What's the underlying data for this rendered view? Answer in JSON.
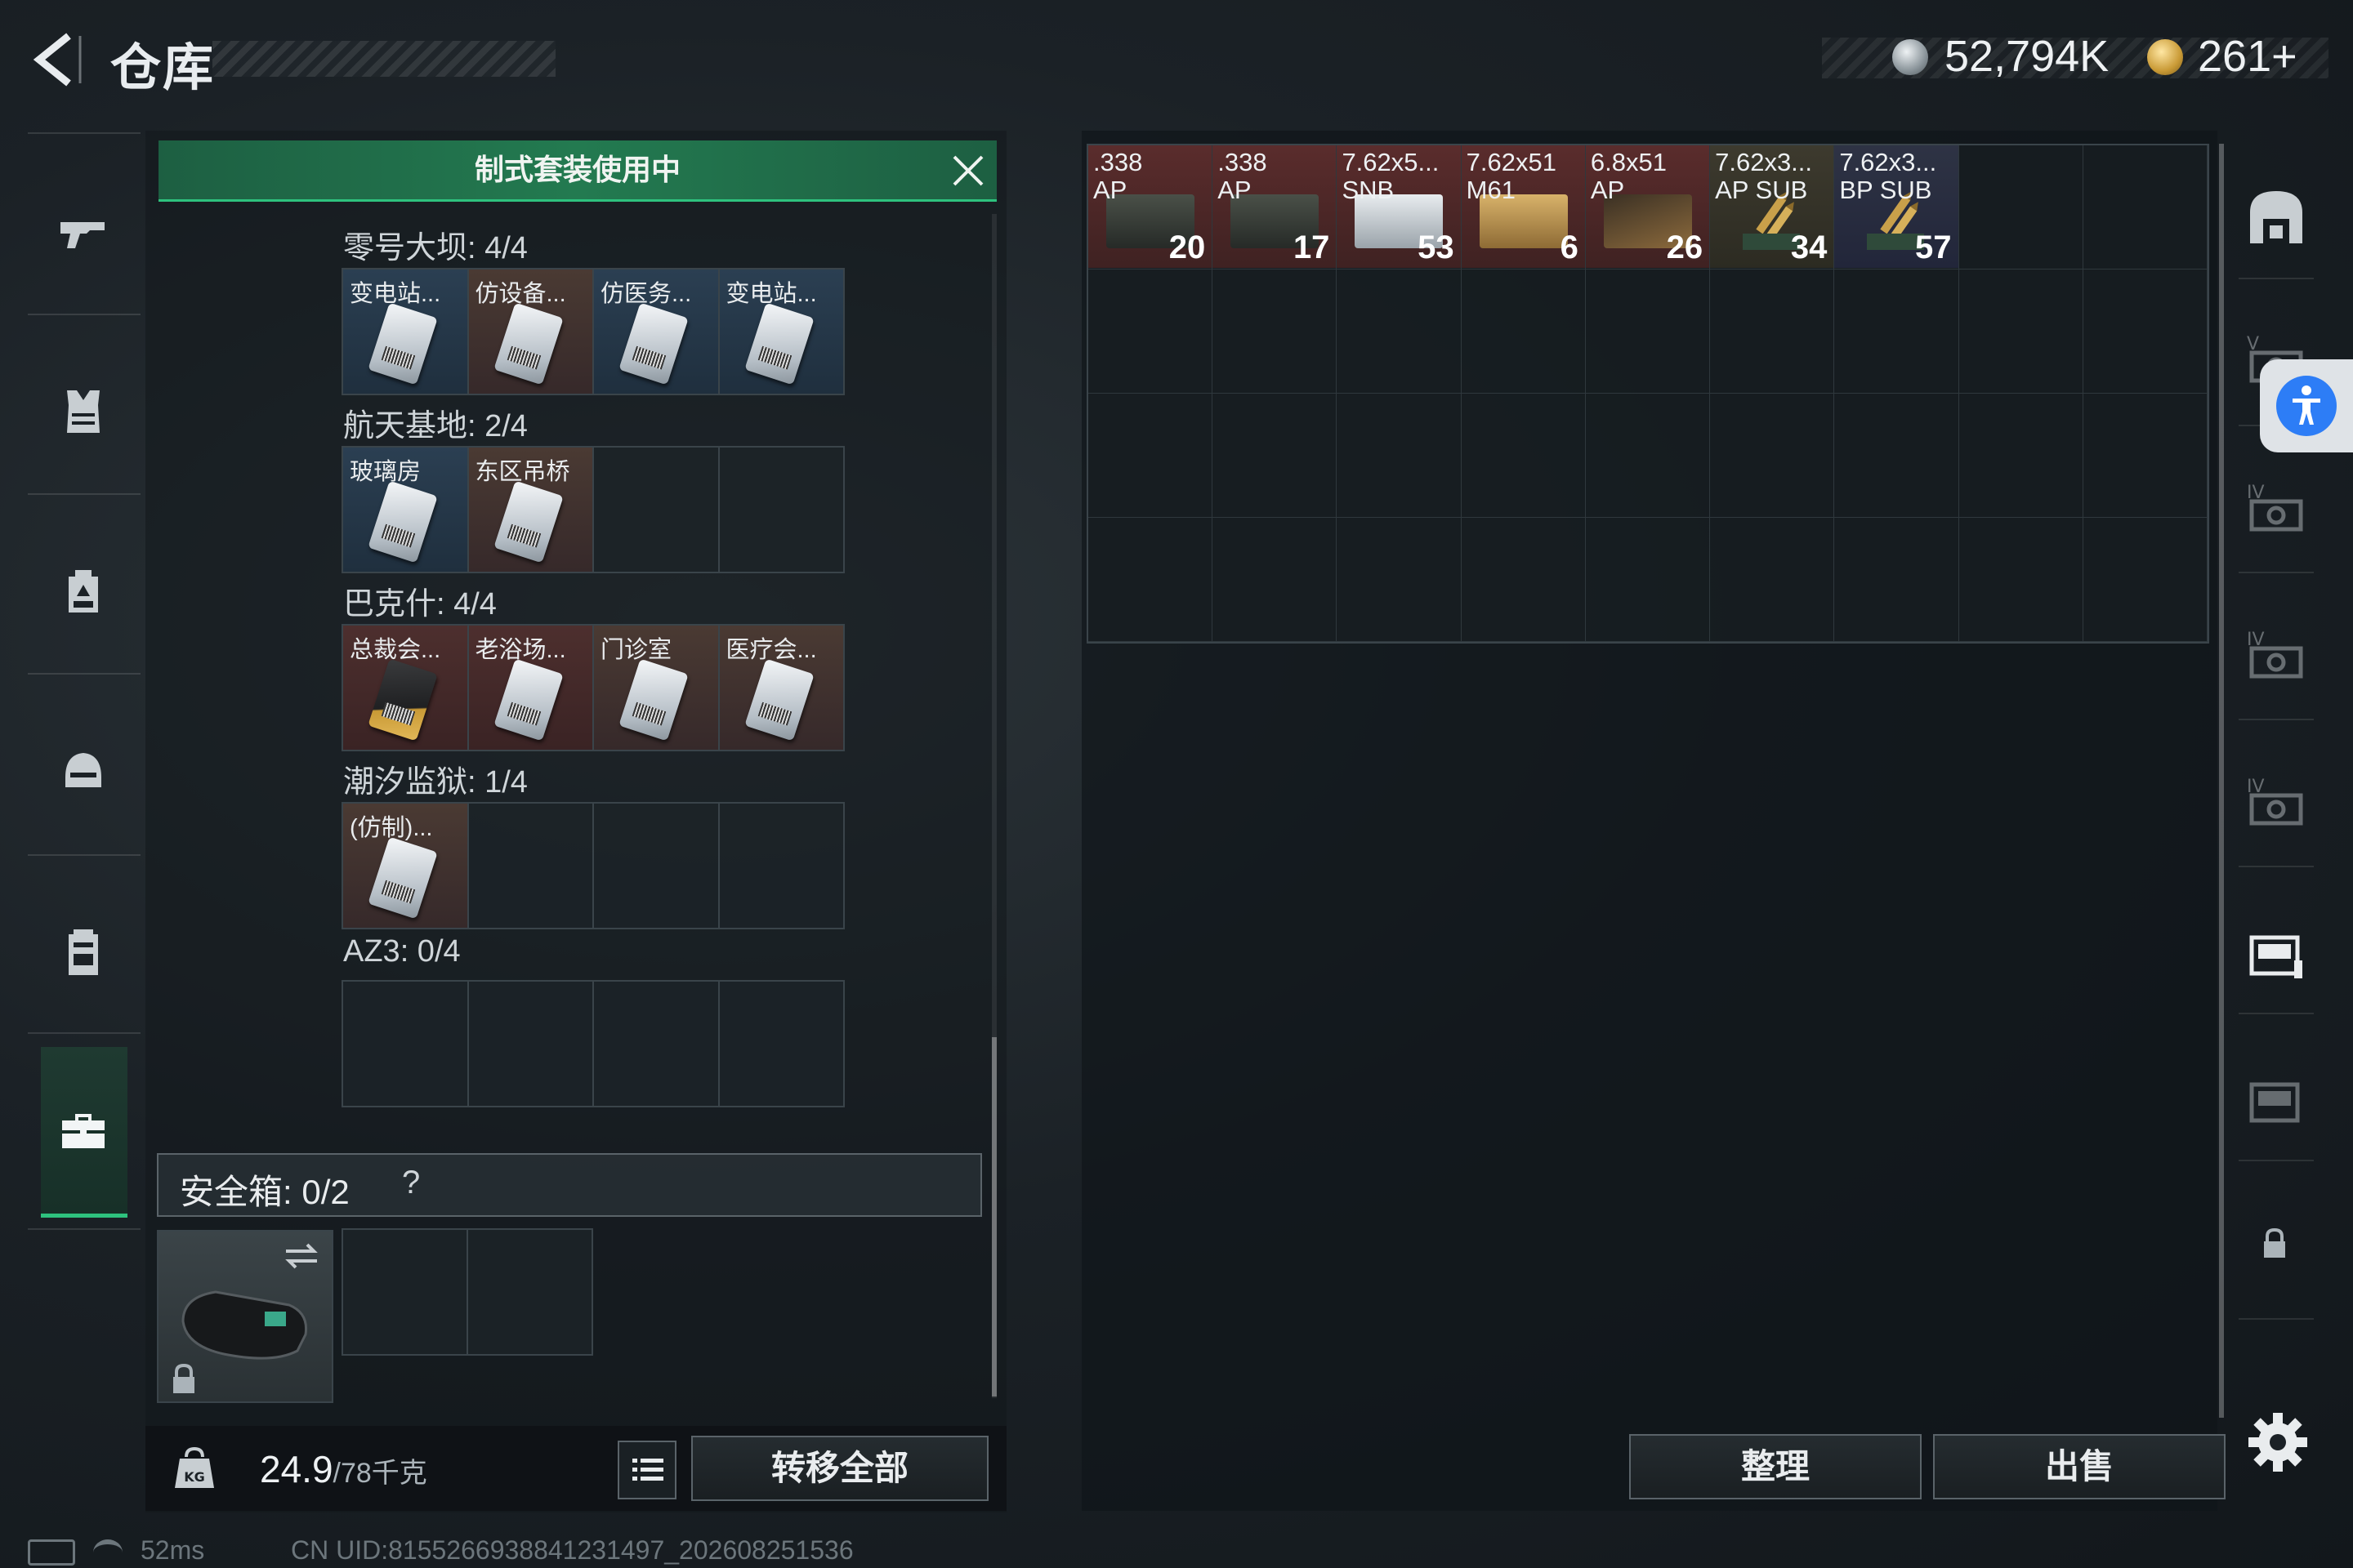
{
  "header": {
    "title": "仓库",
    "money": "52,794K",
    "gold": "261+"
  },
  "sidebar": {
    "items": [
      {
        "icon": "gun-icon"
      },
      {
        "icon": "armor-vest-icon"
      },
      {
        "icon": "backpack-icon"
      },
      {
        "icon": "helmet-icon"
      },
      {
        "icon": "rig-icon"
      },
      {
        "icon": "briefcase-icon",
        "active": true
      }
    ]
  },
  "banner": {
    "text": "制式套装使用中"
  },
  "key_sets": [
    {
      "label": "零号大坝: 4/4",
      "slots": [
        {
          "name": "变电站...",
          "tone": "blue"
        },
        {
          "name": "仿设备...",
          "tone": "brown"
        },
        {
          "name": "仿医务...",
          "tone": "blue"
        },
        {
          "name": "变电站...",
          "tone": "blue"
        }
      ]
    },
    {
      "label": "航天基地: 2/4",
      "slots": [
        {
          "name": "玻璃房",
          "tone": "blue"
        },
        {
          "name": "东区吊桥",
          "tone": "brown"
        },
        {
          "name": "",
          "tone": "empty"
        },
        {
          "name": "",
          "tone": "empty"
        }
      ]
    },
    {
      "label": "巴克什: 4/4",
      "slots": [
        {
          "name": "总裁会...",
          "tone": "red",
          "gold": true
        },
        {
          "name": "老浴场...",
          "tone": "red"
        },
        {
          "name": "门诊室",
          "tone": "brown"
        },
        {
          "name": "医疗会...",
          "tone": "brown"
        }
      ]
    },
    {
      "label": "潮汐监狱: 1/4",
      "slots": [
        {
          "name": "(仿制)...",
          "tone": "brown"
        },
        {
          "name": "",
          "tone": "empty"
        },
        {
          "name": "",
          "tone": "empty"
        },
        {
          "name": "",
          "tone": "empty"
        }
      ]
    },
    {
      "label": "AZ3: 0/4",
      "slots": [
        {
          "name": "",
          "tone": "empty"
        },
        {
          "name": "",
          "tone": "empty"
        },
        {
          "name": "",
          "tone": "empty"
        },
        {
          "name": "",
          "tone": "empty"
        }
      ]
    }
  ],
  "safe_box": {
    "label": "安全箱: 0/2",
    "help": "?"
  },
  "capacity": {
    "value": "24.9",
    "max": "/78千克"
  },
  "buttons": {
    "transfer_all": "转移全部",
    "sort": "整理",
    "sell": "出售"
  },
  "stash_items": [
    {
      "line1": ".338",
      "line2": "AP",
      "count": "20",
      "tone": "red",
      "art": "dark"
    },
    {
      "line1": ".338",
      "line2": "AP",
      "count": "17",
      "tone": "red",
      "art": "dark"
    },
    {
      "line1": "7.62x5...",
      "line2": "SNB",
      "count": "53",
      "tone": "red",
      "art": "white"
    },
    {
      "line1": "7.62x51",
      "line2": "M61",
      "count": "6",
      "tone": "red",
      "art": "tan"
    },
    {
      "line1": "6.8x51",
      "line2": "AP",
      "count": "26",
      "tone": "red",
      "art": "brn"
    },
    {
      "line1": "7.62x3...",
      "line2": "AP SUB",
      "count": "34",
      "tone": "grn",
      "art": "bullets"
    },
    {
      "line1": "7.62x3...",
      "line2": "BP SUB",
      "count": "57",
      "tone": "blu",
      "art": "bullets"
    }
  ],
  "status": {
    "ping": "52ms",
    "uid": "CN UID:8155266938841231497_202608251536"
  },
  "colors": {
    "accent": "#2ec27e",
    "banner": "#237a50",
    "item_red": "#5a2c2c",
    "accessibility": "#2d7df6"
  }
}
